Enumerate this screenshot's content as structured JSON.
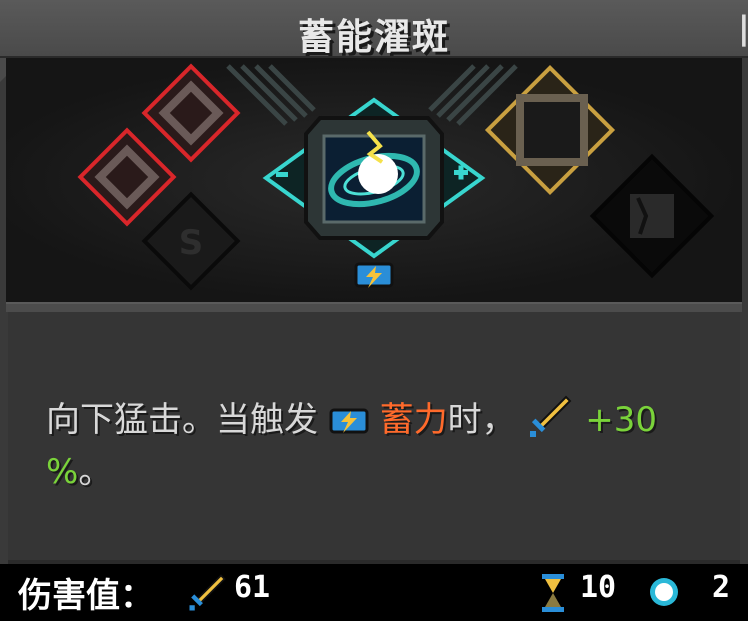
{
  "title": "蓄能濯斑",
  "title_marker": "|",
  "description": {
    "line1_prefix": "向下猛击。当触发",
    "line1_keyword": "蓄力",
    "line1_mid": "时，",
    "line1_bonus": "+30",
    "line2_bonus": "%",
    "line2_end": "。"
  },
  "footer": {
    "damage_label": "伤害值：",
    "damage_value": "61",
    "cooldown_value": "10",
    "orb_value": "2"
  },
  "icons": {
    "center": "blue-vortex-skill-icon",
    "left_slots": [
      "red-rune-slot",
      "red-rune-slot",
      "dark-rune-slot"
    ],
    "right_slots": [
      "gold-rune-slot",
      "dark-rune-slot"
    ],
    "charge_badge": "lightning-charge-icon",
    "sword": "sword-icon",
    "hourglass": "hourglass-icon",
    "orb": "light-orb-icon"
  },
  "colors": {
    "accent_cyan": "#38d6cf",
    "keyword_orange": "#ff6a2b",
    "bonus_green": "#7ad33a",
    "rune_red": "#d9262a",
    "rune_gold": "#c9a040"
  }
}
